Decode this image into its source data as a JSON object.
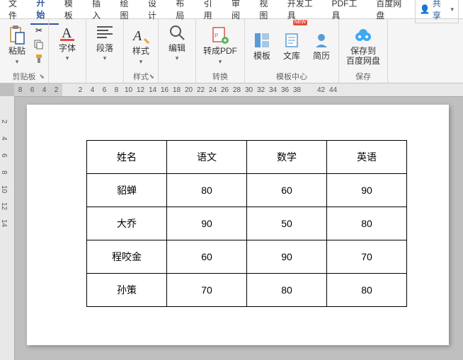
{
  "menu": {
    "file": "文件",
    "start": "开始",
    "template": "模板",
    "insert": "插入",
    "draw": "绘图",
    "design": "设计",
    "layout": "布局",
    "reference": "引用",
    "review": "审阅",
    "view": "视图",
    "dev": "开发工具",
    "pdf": "PDF工具",
    "baidu": "百度网盘",
    "share": "共享"
  },
  "ribbon": {
    "clipboard": {
      "paste": "粘贴",
      "label": "剪贴板"
    },
    "font": {
      "btn": "字体"
    },
    "para": {
      "btn": "段落"
    },
    "style": {
      "btn": "样式",
      "label": "样式"
    },
    "edit": {
      "btn": "编辑"
    },
    "convert": {
      "btn": "转成PDF",
      "label": "转换"
    },
    "templateCenter": {
      "tpl": "模板",
      "lib": "文库",
      "resume": "简历",
      "label": "模板中心",
      "new": "NEW"
    },
    "save": {
      "btn": "保存到\n百度网盘",
      "label": "保存"
    }
  },
  "ruler": {
    "h_neg": [
      "8",
      "6",
      "4",
      "2"
    ],
    "h_pos": [
      "",
      "2",
      "4",
      "6",
      "8",
      "10",
      "12",
      "14",
      "16",
      "18",
      "20",
      "22",
      "24",
      "26",
      "28",
      "30",
      "32",
      "34",
      "36",
      "38",
      "",
      "42",
      "44"
    ],
    "v": [
      "",
      "2",
      "4",
      "6",
      "8",
      "10",
      "12",
      "14"
    ]
  },
  "table": {
    "headers": [
      "姓名",
      "语文",
      "数学",
      "英语"
    ],
    "rows": [
      [
        "貂蝉",
        "80",
        "60",
        "90"
      ],
      [
        "大乔",
        "90",
        "50",
        "80"
      ],
      [
        "程咬金",
        "60",
        "90",
        "70"
      ],
      [
        "孙策",
        "70",
        "80",
        "80"
      ]
    ]
  },
  "chart_data": {
    "type": "table",
    "title": "",
    "columns": [
      "姓名",
      "语文",
      "数学",
      "英语"
    ],
    "rows": [
      {
        "姓名": "貂蝉",
        "语文": 80,
        "数学": 60,
        "英语": 90
      },
      {
        "姓名": "大乔",
        "语文": 90,
        "数学": 50,
        "英语": 80
      },
      {
        "姓名": "程咬金",
        "语文": 60,
        "数学": 90,
        "英语": 70
      },
      {
        "姓名": "孙策",
        "语文": 70,
        "数学": 80,
        "英语": 80
      }
    ]
  }
}
